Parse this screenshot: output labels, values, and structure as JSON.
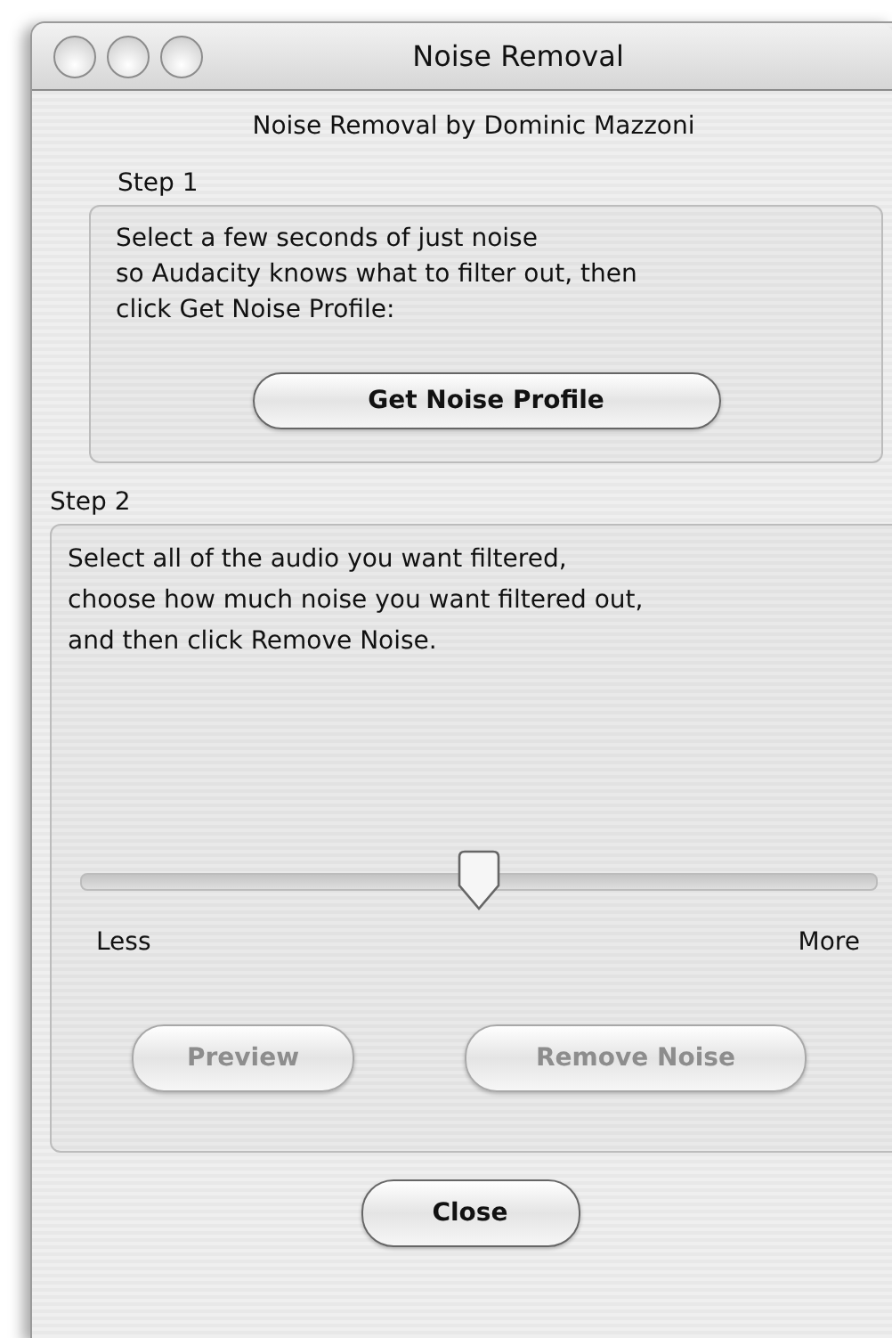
{
  "window": {
    "title": "Noise Removal"
  },
  "heading": "Noise Removal by Dominic Mazzoni",
  "step1": {
    "label": "Step 1",
    "text": "Select a few seconds of just noise\nso Audacity knows what to filter out, then\nclick Get Noise Profile:",
    "button": {
      "label": "Get Noise Profile",
      "disabled": false
    }
  },
  "step2": {
    "label": "Step 2",
    "text": "Select all of the audio you want filtered,\nchoose how much noise you want filtered out,\nand then click Remove Noise.",
    "slider": {
      "level": 0.5,
      "min_label": "Less",
      "max_label": "More"
    },
    "buttons": [
      {
        "label": "Preview",
        "disabled": true
      },
      {
        "label": "Remove Noise",
        "disabled": true
      }
    ]
  },
  "footer_button": {
    "label": "Close",
    "disabled": false
  }
}
